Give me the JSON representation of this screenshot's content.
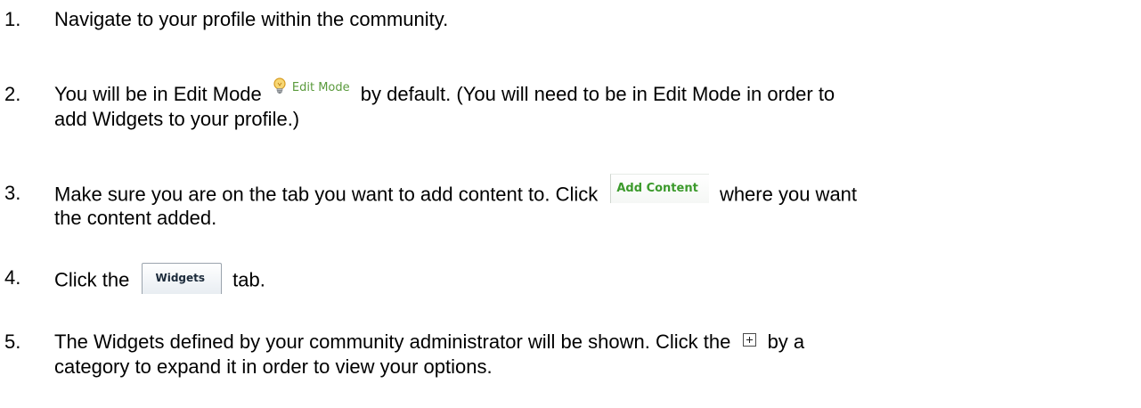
{
  "steps": [
    {
      "number": "1.",
      "text": "Navigate to your profile within the community."
    },
    {
      "number": "2.",
      "text_before": "You will be in Edit Mode",
      "chip_label": "Edit Mode",
      "text_after": "by default. (You will need to be in Edit Mode in order to",
      "line2": "add Widgets to your profile.)"
    },
    {
      "number": "3.",
      "text_before": "Make sure you are on the tab you want to add content to. Click",
      "chip_label": "Add Content",
      "text_after": "where you want",
      "line2": "the content added."
    },
    {
      "number": "4.",
      "text_before": "Click the",
      "chip_label": "Widgets",
      "text_after": "tab."
    },
    {
      "number": "5.",
      "text_before": "The Widgets defined by your community administrator will be shown. Click the",
      "chip_icon": "expand-plus-icon",
      "text_after": "by a",
      "line2": "category to expand it in order to view your options."
    }
  ],
  "colors": {
    "edit_mode_text": "#5a9a3c",
    "add_content_text": "#3c9a2c",
    "widgets_text": "#1b2a3a"
  }
}
